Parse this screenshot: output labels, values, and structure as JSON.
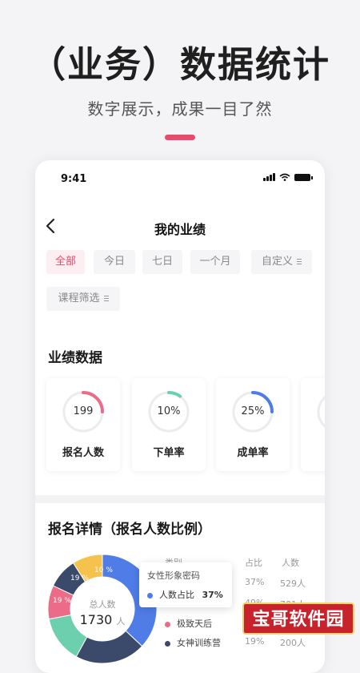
{
  "hero": {
    "title": "（业务）数据统计",
    "subtitle": "数字展示，成果一目了然"
  },
  "status_bar": {
    "time": "9:41"
  },
  "nav": {
    "title": "我的业绩"
  },
  "filters": {
    "chips": [
      "全部",
      "今日",
      "七日",
      "一个月",
      "自定义"
    ],
    "course_filter": "课程筛选",
    "active_index": 0
  },
  "performance": {
    "title": "业绩数据",
    "cards": [
      {
        "value": "199",
        "label": "报名人数",
        "color": "#ec6b86",
        "fraction": 0.25
      },
      {
        "value": "10%",
        "label": "下单率",
        "color": "#6ccfae",
        "fraction": 0.1
      },
      {
        "value": "25%",
        "label": "成单率",
        "color": "#4f7ce6",
        "fraction": 0.25
      }
    ]
  },
  "registration": {
    "title": "报名详情（报名人数比例）",
    "total_label": "总人数",
    "total_value": "1730",
    "total_unit": "人",
    "table_headers": {
      "category": "类别",
      "share": "占比",
      "count": "人数"
    },
    "rows": [
      {
        "share": "37%",
        "count": "529人"
      },
      {
        "share": "49%",
        "count": "701人"
      },
      {
        "share": "",
        "count": ""
      },
      {
        "share": "19%",
        "count": "200人"
      }
    ],
    "legend": [
      {
        "label": "极致天后",
        "color": "#ec6b86"
      },
      {
        "label": "女神训练营",
        "color": "#3b4a6b"
      }
    ],
    "tooltip": {
      "title": "女性形象密码",
      "series": "人数占比",
      "value": "37%",
      "color": "#4f7ce6"
    },
    "slice_labels": [
      "19 %",
      "10 %",
      "19 %"
    ],
    "slices": [
      {
        "value": 37,
        "color": "#4f7ce6"
      },
      {
        "value": 21,
        "color": "#3b4a6b"
      },
      {
        "value": 14,
        "color": "#6ccfae"
      },
      {
        "value": 10,
        "color": "#ec6b86"
      },
      {
        "value": 9,
        "color": "#3b4a6b"
      },
      {
        "value": 9,
        "color": "#f4c24d"
      }
    ]
  },
  "watermark": "宝哥软件园"
}
